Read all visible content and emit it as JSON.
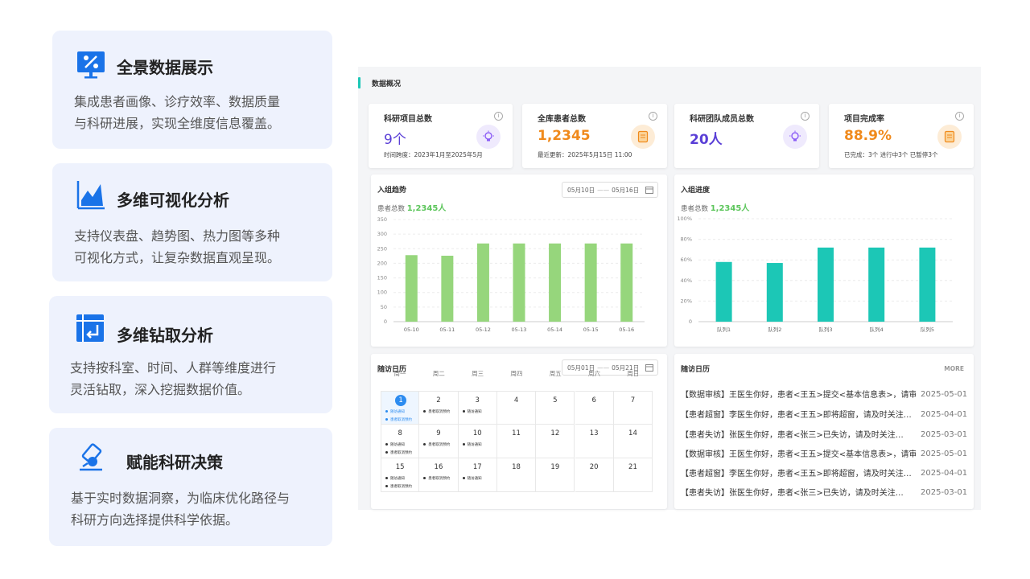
{
  "features": [
    {
      "icon": "data-display-icon",
      "title": "全景数据展示",
      "desc_lines": [
        "集成患者画像、诊疗效率、数据质量",
        "与科研进展，实现全维度信息覆盖。"
      ]
    },
    {
      "icon": "area-chart-icon",
      "title": "多维可视化分析",
      "desc_lines": [
        "支持仪表盘、趋势图、热力图等多种",
        "可视化方式，让复杂数据直观呈现。"
      ]
    },
    {
      "icon": "drill-down-icon",
      "title": "多维钻取分析",
      "desc_lines": [
        "支持按科室、时间、人群等维度进行",
        "灵活钻取，深入挖掘数据价值。"
      ]
    },
    {
      "icon": "decision-icon",
      "title": "赋能科研决策",
      "desc_lines": [
        "基于实时数据洞察，为临床优化路径与",
        "科研方向选择提供科学依据。"
      ]
    }
  ],
  "dashboard": {
    "title": "数据概况",
    "kpis": [
      {
        "label": "科研项目总数",
        "value": "9个",
        "sub": "时间跨度：2023年1月至2025年5月",
        "color": "#5a3fd6",
        "badge": "bulb-icon"
      },
      {
        "label": "全库患者总数",
        "value": "1,2345",
        "sub": "最近更新：2025年5月15日 11:00",
        "color": "#f08a1c",
        "badge": "doc-icon"
      },
      {
        "label": "科研团队成员总数",
        "value": "20人",
        "sub": "",
        "color": "#5a3fd6",
        "badge": "bulb-icon"
      },
      {
        "label": "项目完成率",
        "value": "88.9%",
        "sub": "已完成：3个 进行中3个 已暂停3个",
        "color": "#f08a1c",
        "badge": "doc-icon"
      }
    ],
    "info_glyph": "i",
    "trend": {
      "title": "入组趋势",
      "sub_label": "患者总数",
      "sub_value": "1,2345人",
      "date_from": "05月10日",
      "date_sep": "——",
      "date_to": "05月16日"
    },
    "progress": {
      "title": "入组进度",
      "sub_label": "患者总数",
      "sub_value": "1,2345人"
    },
    "calendar": {
      "title": "随访日历",
      "date_from": "05月01日",
      "date_sep": "——",
      "date_to": "05月21日",
      "weekdays": [
        "周一",
        "周二",
        "周三",
        "周四",
        "周五",
        "周六",
        "周日"
      ],
      "weeks": [
        [
          {
            "day": "1",
            "today": true,
            "events": [
              {
                "text": "随访通知",
                "color": "#2d8cf0"
              },
              {
                "text": "患者取消预约",
                "color": "#2d8cf0"
              }
            ]
          },
          {
            "day": "2",
            "events": [
              {
                "text": "患者取消预约",
                "color": "#333"
              }
            ]
          },
          {
            "day": "3",
            "events": [
              {
                "text": "随访通知",
                "color": "#333"
              }
            ]
          },
          {
            "day": "4",
            "events": []
          },
          {
            "day": "5",
            "events": []
          },
          {
            "day": "6",
            "events": []
          },
          {
            "day": "7",
            "events": []
          }
        ],
        [
          {
            "day": "8",
            "events": [
              {
                "text": "随访通知",
                "color": "#333"
              },
              {
                "text": "患者取消预约",
                "color": "#333"
              }
            ]
          },
          {
            "day": "9",
            "events": [
              {
                "text": "患者取消预约",
                "color": "#333"
              }
            ]
          },
          {
            "day": "10",
            "events": [
              {
                "text": "随访通知",
                "color": "#333"
              }
            ]
          },
          {
            "day": "11",
            "events": []
          },
          {
            "day": "12",
            "events": []
          },
          {
            "day": "13",
            "events": []
          },
          {
            "day": "14",
            "events": []
          }
        ],
        [
          {
            "day": "15",
            "events": [
              {
                "text": "随访通知",
                "color": "#333"
              },
              {
                "text": "患者取消预约",
                "color": "#333"
              }
            ]
          },
          {
            "day": "16",
            "events": [
              {
                "text": "患者取消预约",
                "color": "#333"
              }
            ]
          },
          {
            "day": "17",
            "events": [
              {
                "text": "随访通知",
                "color": "#333"
              }
            ]
          },
          {
            "day": "18",
            "events": []
          },
          {
            "day": "19",
            "events": []
          },
          {
            "day": "20",
            "events": []
          },
          {
            "day": "21",
            "events": []
          }
        ]
      ]
    },
    "notices": {
      "title": "随访日历",
      "more": "MORE",
      "items": [
        {
          "text": "【数据审核】王医生你好，患者<王五>提交<基本信息表>，请审…",
          "date": "2025-05-01"
        },
        {
          "text": "【患者超窗】李医生你好，患者<王五>即将超窗，请及时关注…",
          "date": "2025-04-01"
        },
        {
          "text": "【患者失访】张医生你好，患者<张三>已失访，请及时关注…",
          "date": "2025-03-01"
        },
        {
          "text": "【数据审核】王医生你好，患者<王五>提交<基本信息表>，请审…",
          "date": "2025-05-01"
        },
        {
          "text": "【患者超窗】李医生你好，患者<王五>即将超窗，请及时关注…",
          "date": "2025-04-01"
        },
        {
          "text": "【患者失访】张医生你好，患者<张三>已失访，请及时关注…",
          "date": "2025-03-01"
        }
      ]
    }
  },
  "chart_data": [
    {
      "type": "bar",
      "title": "入组趋势",
      "categories": [
        "05-10",
        "05-11",
        "05-12",
        "05-13",
        "05-14",
        "05-15",
        "05-16"
      ],
      "values": [
        228,
        226,
        268,
        268,
        268,
        268,
        268
      ],
      "ylim": [
        0,
        350
      ],
      "yticks": [
        "0",
        "50",
        "100",
        "150",
        "200",
        "250",
        "300",
        "350"
      ],
      "color": "#96d67c",
      "grid": true
    },
    {
      "type": "bar",
      "title": "入组进度",
      "categories": [
        "队列1",
        "队列2",
        "队列3",
        "队列4",
        "队列5"
      ],
      "values": [
        58,
        57,
        72,
        72,
        72
      ],
      "ylim": [
        0,
        100
      ],
      "yticks": [
        "0",
        "20%",
        "40%",
        "60%",
        "80%",
        "100%"
      ],
      "color": "#1cc7b6",
      "grid": true
    }
  ]
}
